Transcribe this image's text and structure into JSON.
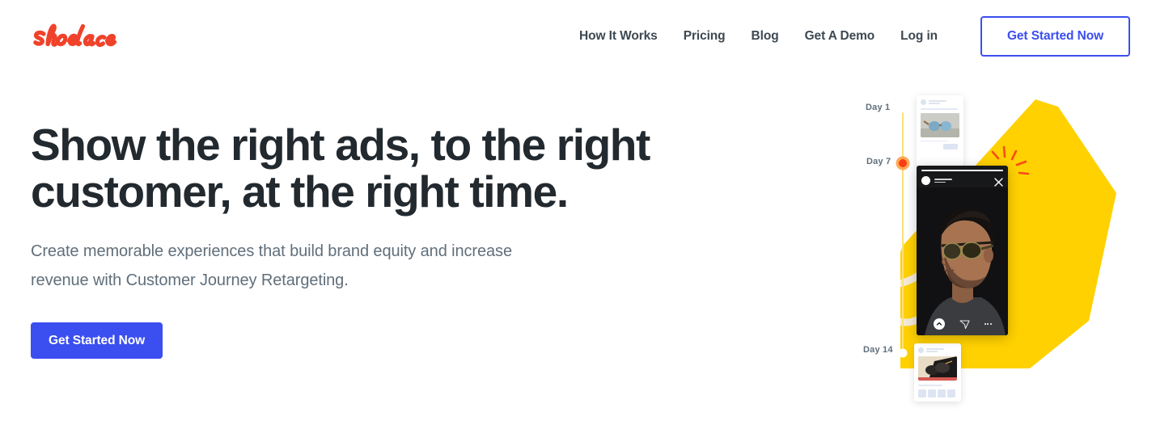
{
  "brand": {
    "logo_text": "shoelace",
    "logo_color": "#f0422a",
    "accent_blue": "#3b4ef0",
    "accent_yellow": "#ffd100",
    "accent_cream": "#f4ead9",
    "accent_orange": "#fa5914",
    "text_dark": "#22292f",
    "text_muted": "#606f7b"
  },
  "nav": {
    "links": [
      {
        "label": "How It Works"
      },
      {
        "label": "Pricing"
      },
      {
        "label": "Blog"
      },
      {
        "label": "Get A Demo"
      },
      {
        "label": "Log in"
      }
    ],
    "cta_label": "Get Started Now"
  },
  "hero": {
    "title": "Show the right ads, to the right customer, at the right time.",
    "subtitle": "Create memorable experiences that build brand equity and increase revenue with Customer Journey Retargeting.",
    "cta_label": "Get Started Now"
  },
  "illustration": {
    "timeline": [
      {
        "label": "Day 1",
        "marker": "white-dot"
      },
      {
        "label": "Day 7",
        "marker": "orange-dot"
      },
      {
        "label": "Day 14",
        "marker": "white-dot"
      }
    ],
    "icons": {
      "close": "close-icon",
      "send": "send-icon",
      "more": "more-icon",
      "chevron_up": "chevron-up-icon",
      "spark": "spark-burst-icon"
    }
  }
}
